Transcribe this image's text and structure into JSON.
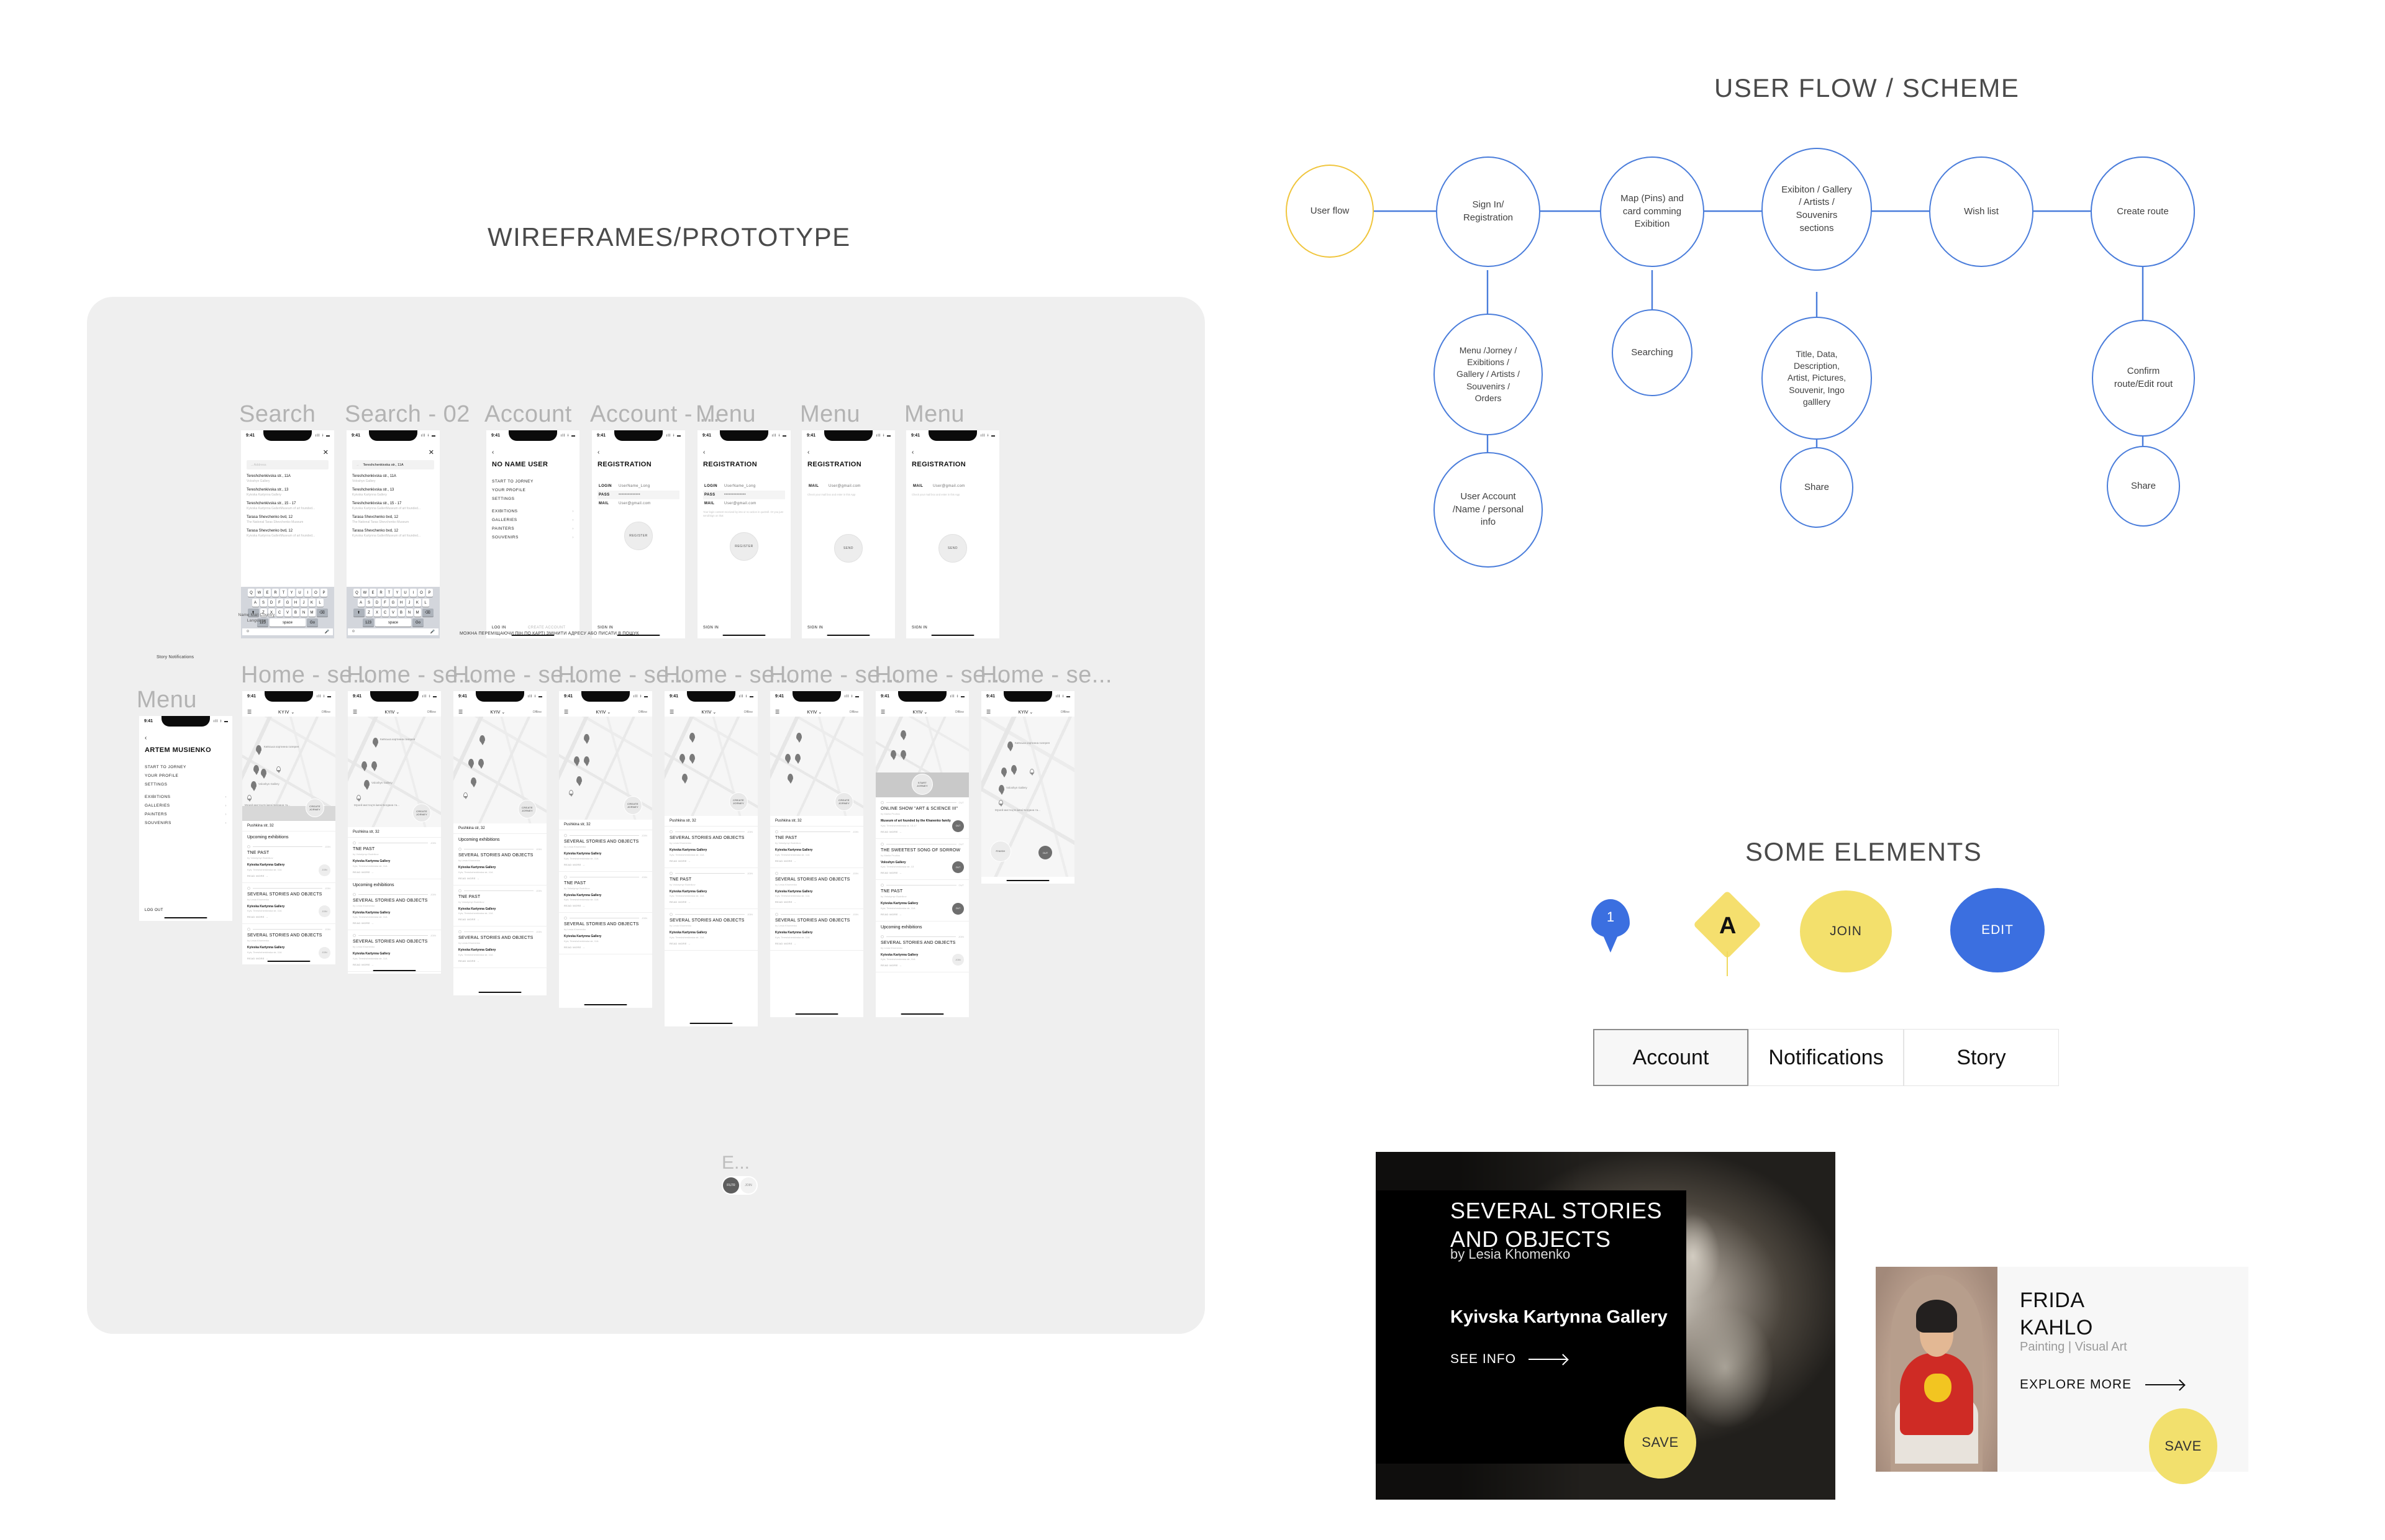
{
  "sections": {
    "wireframes_title": "WIREFRAMES/PROTOTYPE",
    "userflow_title": "USER FLOW / SCHEME",
    "elements_title": "SOME ELEMENTS"
  },
  "colors": {
    "accent_blue": "#3b6fe0",
    "node_blue": "#4a7ddb",
    "accent_yellow": "#f3e06c",
    "node_yellow": "#f0c53c",
    "panel_gray": "#efefef",
    "label_gray": "#b3b3b3"
  },
  "userflow": {
    "nodes": [
      {
        "id": "start",
        "label": "User flow"
      },
      {
        "id": "signin",
        "label": "Sign In/\nRegistration"
      },
      {
        "id": "map",
        "label": "Map (Pins) and\ncard comming\nExibition"
      },
      {
        "id": "sections",
        "label": "Exibiton / Gallery\n/ Artists /\nSouvenirs\nsections"
      },
      {
        "id": "wish",
        "label": "Wish list"
      },
      {
        "id": "route",
        "label": "Create route"
      },
      {
        "id": "menu",
        "label": "Menu /Jorney /\nExibitions /\nGallery / Artists /\nSouvenirs /\nOrders"
      },
      {
        "id": "search",
        "label": "Searching"
      },
      {
        "id": "details",
        "label": "Title, Data,\nDescription,\nArtist, Pictures,\nSouvenir, Ingo\ngalllery"
      },
      {
        "id": "confirm",
        "label": "Confirm\nroute/Edit rout"
      },
      {
        "id": "account",
        "label": "User Account\n/Name / personal\ninfo"
      },
      {
        "id": "share1",
        "label": "Share"
      },
      {
        "id": "share2",
        "label": "Share"
      }
    ]
  },
  "elements": {
    "map_pin_number": "1",
    "map_pin_letter": "A",
    "join_label": "JOIN",
    "edit_label": "EDIT",
    "tabs": [
      {
        "label": "Account",
        "active": true
      },
      {
        "label": "Notifications",
        "active": false
      },
      {
        "label": "Story",
        "active": false
      }
    ]
  },
  "cards": {
    "dark": {
      "title_line1": "SEVERAL STORIES",
      "title_line2": "AND OBJECTS",
      "author": "by Lesia Khomenko",
      "gallery": "Kyivska Kartynna Gallery",
      "cta": "SEE INFO",
      "save": "SAVE"
    },
    "light": {
      "title_line1": "FRIDA",
      "title_line2": "KAHLO",
      "subtitle": "Painting | Visual Art",
      "cta": "EXPLORE MORE",
      "save": "SAVE"
    }
  },
  "wireframes": {
    "annotations": {
      "menu_top": "Name\nMail\nCountry\nLanguage",
      "menu_top2": "Story\nNotifications",
      "map_note": "МОЖНА ПЕРЕМІЩАЮЧИ ПІН ПО\nКАРТІ ЗМІНИТИ АДРЕСУ\nАБО ПИСАТИ В ПОШУК",
      "ellipsis": "E..."
    },
    "toggle": {
      "left": "FILTR",
      "right": "JOIN"
    },
    "status": {
      "time": "9:41",
      "icons": "ıll ᚼ ▬"
    },
    "row1": [
      {
        "label": "Search",
        "type": "search",
        "placeholder": "Address"
      },
      {
        "label": "Search - 02",
        "type": "search",
        "query": "Tereshchenkivska str., 11A"
      },
      {
        "label": "Account",
        "type": "account"
      },
      {
        "label": "Account - ...",
        "type": "registration",
        "variant": "full"
      },
      {
        "label": "Menu",
        "type": "registration",
        "variant": "full-hint"
      },
      {
        "label": "Menu",
        "type": "registration",
        "variant": "mail"
      },
      {
        "label": "Menu",
        "type": "registration",
        "variant": "mail"
      }
    ],
    "row2": [
      {
        "label": "Menu",
        "type": "sidebar"
      },
      {
        "label": "Home - se...",
        "type": "map"
      },
      {
        "label": "Home - se...",
        "type": "map"
      },
      {
        "label": "Home - se...",
        "type": "map"
      },
      {
        "label": "Home - se...",
        "type": "map"
      },
      {
        "label": "Home - se...",
        "type": "map"
      },
      {
        "label": "Home - se...",
        "type": "map"
      },
      {
        "label": "Home - se...",
        "type": "map"
      },
      {
        "label": "Home - se...",
        "type": "map"
      }
    ],
    "search_screen": {
      "placeholder": "Address",
      "query": "Tereshchenkivska str., 11A",
      "results": [
        {
          "addr": "Tereshchenkivska str., 11A",
          "sub": "Voloshyn Gallery"
        },
        {
          "addr": "Tereshchenkivska str., 13",
          "sub": "Kyivska Kartynna Gallery"
        },
        {
          "addr": "Tereshchenkivska str., 15 - 17",
          "sub": "Kyivska Kartynna GalleriMuseum of art founded..."
        },
        {
          "addr": "Tarasa Shevchenko bvd, 12",
          "sub": "The National Taras Shevchenko Museum"
        },
        {
          "addr": "Tarasa Shevchenko bvd, 12",
          "sub": "Kyivska Kartynna GalleriMuseum of art founded..."
        }
      ],
      "keyboard": {
        "row1": [
          "Q",
          "W",
          "E",
          "R",
          "T",
          "Y",
          "U",
          "I",
          "O",
          "P"
        ],
        "row2": [
          "A",
          "S",
          "D",
          "F",
          "G",
          "H",
          "J",
          "K",
          "L"
        ],
        "row3": [
          "Z",
          "X",
          "C",
          "V",
          "B",
          "N",
          "M"
        ],
        "num": "123",
        "space": "space",
        "go": "Go"
      }
    },
    "account_screen": {
      "title": "NO NAME USER",
      "items": [
        "START TO JORNEY",
        "YOUR PROFILE",
        "SETTINGS"
      ],
      "sections": [
        "EXIBITIONS",
        "GALLERIES",
        "PAINTERS",
        "SOUVENIRS"
      ],
      "footer_left": "LOG IN",
      "footer_right": "CREATE ACCOUNT"
    },
    "sidebar_screen": {
      "title": "ARTEM MUSIENKO",
      "items": [
        "START TO JORNEY",
        "YOUR PROFILE",
        "SETTINGS"
      ],
      "sections": [
        "EXIBITIONS",
        "GALLERIES",
        "PAINTERS",
        "SOUVENIRS"
      ],
      "footer_left": "LOG OUT"
    },
    "registration_screen": {
      "title": "REGISTRATION",
      "fields": [
        {
          "label": "LOGIN",
          "value": "UserName_Long"
        },
        {
          "label": "PASS",
          "value": "••••••••••••••"
        },
        {
          "label": "MAIL",
          "value": "User@gmail.com"
        }
      ],
      "hint": "Your login content received by into or no action in quotroll.\nOr you just send/Sign on that",
      "mail_hint": "Check your mail box and enter in this App",
      "button_register": "REGISTER",
      "button_send": "SEND",
      "footer": "SIGN IN"
    },
    "map_screen": {
      "city": "KYIV",
      "status_right": "Offline",
      "address": "Pushkina str, 32",
      "section_header": "Upcoming exhibitions",
      "cta_create": "CREATE\nJORNEY",
      "cta_start": "START\nJORNEY",
      "cta_finish": "FINISH",
      "pins": [
        "Київська\nкартинна галерея",
        "Мистецька гірка",
        "Voloshyn Gallery",
        "Музей мистецтв\nімені Богдана та..."
      ],
      "cards": [
        {
          "title": "TNE PAST",
          "by": "by Volodymyr Budnikov",
          "gallery": "Kyivska Kartynna Gallery",
          "addr": "Kyiv, Tereshchenkivska str, 11A",
          "more": "READ MORE",
          "join": "JOIN"
        },
        {
          "title": "SEVERAL STORIES AND OBJECTS",
          "by": "by Lesia Khomenko",
          "gallery": "Kyivska Kartynna Gallery",
          "addr": "Kyiv, Tereshchenkivska str, 11A",
          "more": "READ MORE",
          "join": "JOIN"
        },
        {
          "title": "SEVERAL STORIES AND OBJECTS",
          "by": "by Lesia Khomenko",
          "gallery": "Kyivska Kartynna Gallery",
          "addr": "Kyiv, Tereshchenkivska str, 11A",
          "more": "READ MORE",
          "join": "JOIN"
        },
        {
          "title": "ONLINE SHOW \"ART & SCIENCE III\"",
          "by": "by Mariia Prodius",
          "gallery": "Museum of art founded by the Khanenko family",
          "addr": "Kyiv, Tereshchenkivska st, 15-17",
          "more": "READ MORE",
          "join": "OUT"
        },
        {
          "title": "THE SWEETEST SONG OF SORROW",
          "by": "by Mariia Prodius",
          "gallery": "Voloshyn Gallery",
          "addr": "Kyiv, Tereshchenkivska str, 13",
          "more": "READ MORE",
          "join": "OUT"
        }
      ]
    }
  }
}
